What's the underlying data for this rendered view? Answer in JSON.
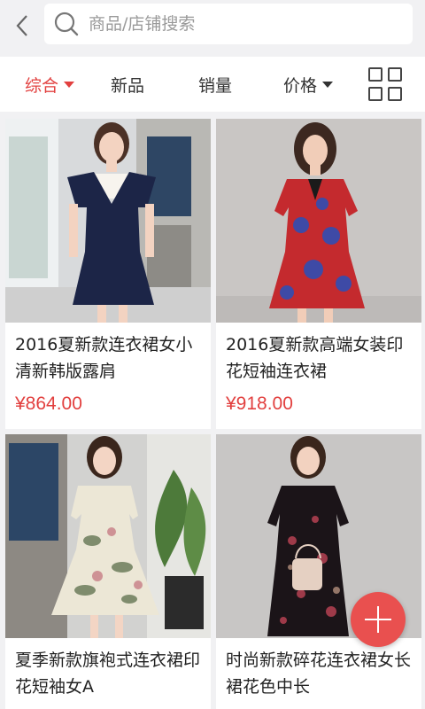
{
  "search": {
    "placeholder": "商品/店铺搜索"
  },
  "sort_bar": {
    "items": [
      {
        "label": "综合",
        "active": true,
        "has_caret": true
      },
      {
        "label": "新品",
        "active": false,
        "has_caret": false
      },
      {
        "label": "销量",
        "active": false,
        "has_caret": false
      },
      {
        "label": "价格",
        "active": false,
        "has_caret": true
      }
    ],
    "view_toggle_icon": "grid-view-icon"
  },
  "products": [
    {
      "title": "2016夏新款连衣裙女小清新韩版露肩",
      "price": "¥864.00"
    },
    {
      "title": "2016夏新款高端女装印花短袖连衣裙",
      "price": "¥918.00"
    },
    {
      "title": "夏季新款旗袍式连衣裙印花短袖女A",
      "price": ""
    },
    {
      "title": "时尚新款碎花连衣裙女长裙花色中长",
      "price": ""
    }
  ],
  "fab": {
    "icon": "plus-icon"
  },
  "colors": {
    "accent": "#e2403f",
    "fab": "#e9504f",
    "background": "#f1f1f3"
  }
}
